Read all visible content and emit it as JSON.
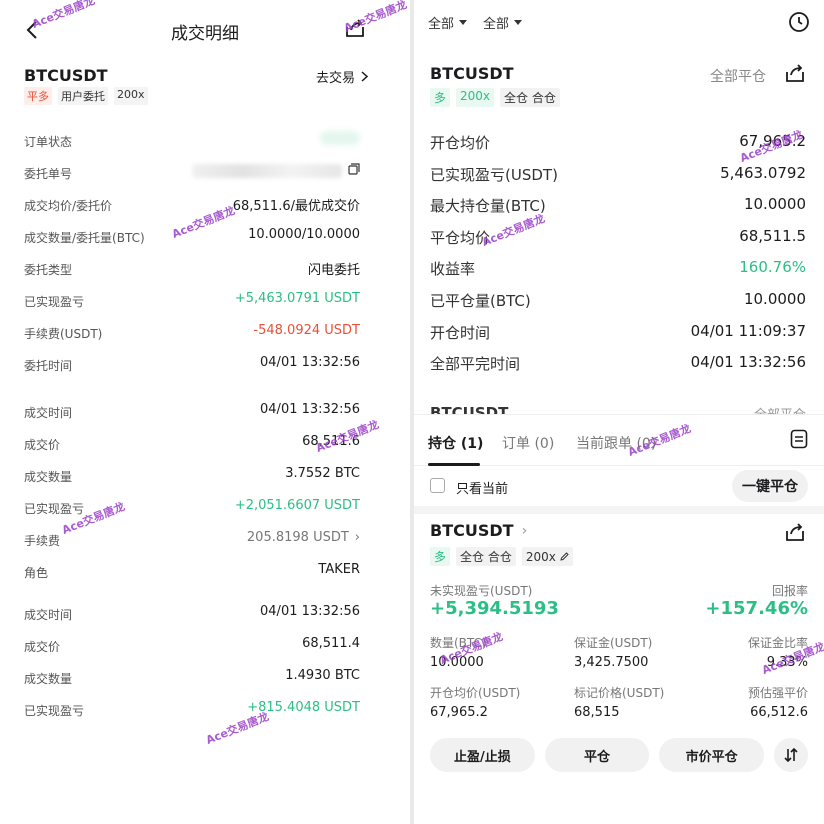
{
  "left": {
    "title": "成交明细",
    "symbol": "BTCUSDT",
    "goto_label": "去交易",
    "tags": [
      "平多",
      "用户委托",
      "200x"
    ],
    "order_rows": [
      {
        "label": "订单状态",
        "value": "",
        "style": "blur-short"
      },
      {
        "label": "委托单号",
        "value": "",
        "style": "blur"
      },
      {
        "label": "成交均价/委托价",
        "value": "68,511.6/最优成交价",
        "style": ""
      },
      {
        "label": "成交数量/委托量(BTC)",
        "value": "10.0000/10.0000",
        "style": ""
      },
      {
        "label": "委托类型",
        "value": "闪电委托",
        "style": ""
      },
      {
        "label": "已实现盈亏",
        "value": "+5,463.0791 USDT",
        "style": "green"
      },
      {
        "label": "手续费(USDT)",
        "value": "-548.0924 USDT",
        "style": "red"
      },
      {
        "label": "委托时间",
        "value": "04/01 13:32:56",
        "style": ""
      }
    ],
    "fill1_rows": [
      {
        "label": "成交时间",
        "value": "04/01 13:32:56",
        "style": ""
      },
      {
        "label": "成交价",
        "value": "68,511.6",
        "style": ""
      },
      {
        "label": "成交数量",
        "value": "3.7552 BTC",
        "style": ""
      },
      {
        "label": "已实现盈亏",
        "value": "+2,051.6607 USDT",
        "style": "green"
      },
      {
        "label": "手续费",
        "value": "205.8198 USDT",
        "style": "grey"
      },
      {
        "label": "角色",
        "value": "TAKER",
        "style": ""
      }
    ],
    "fill2_rows": [
      {
        "label": "成交时间",
        "value": "04/01 13:32:56",
        "style": ""
      },
      {
        "label": "成交价",
        "value": "68,511.4",
        "style": ""
      },
      {
        "label": "成交数量",
        "value": "1.4930 BTC",
        "style": ""
      },
      {
        "label": "已实现盈亏",
        "value": "+815.4048 USDT",
        "style": "green"
      }
    ]
  },
  "right": {
    "filters": [
      "全部",
      "全部"
    ],
    "symbol": "BTCUSDT",
    "close_all": "全部平仓",
    "tags": [
      "多",
      "200x",
      "全仓 合仓"
    ],
    "rows": [
      {
        "label": "开仓均价",
        "value": "67,965.2",
        "style": ""
      },
      {
        "label": "已实现盈亏(USDT)",
        "value": "5,463.0792",
        "style": ""
      },
      {
        "label": "最大持仓量(BTC)",
        "value": "10.0000",
        "style": ""
      },
      {
        "label": "平仓均价",
        "value": "68,511.5",
        "style": ""
      },
      {
        "label": "收益率",
        "value": "160.76%",
        "style": "green"
      },
      {
        "label": "已平仓量(BTC)",
        "value": "10.0000",
        "style": ""
      },
      {
        "label": "开仓时间",
        "value": "04/01 11:09:37",
        "style": ""
      },
      {
        "label": "全部平完时间",
        "value": "04/01 13:32:56",
        "style": ""
      }
    ],
    "peek_symbol": "BTCUSDT",
    "peek_right": "全部平仓",
    "tabs": [
      "持仓 (1)",
      "订单 (0)",
      "当前跟单 (0)"
    ],
    "only_current": "只看当前",
    "one_key_close": "一键平仓",
    "position": {
      "symbol": "BTCUSDT",
      "tags": [
        "多",
        "全仓 合仓",
        "200x"
      ],
      "pnl_label": "未实现盈亏(USDT)",
      "pnl_value": "+5,394.5193",
      "roe_label": "回报率",
      "roe_value": "+157.46%",
      "cells": [
        {
          "label": "数量(BTC)",
          "value": "10.0000"
        },
        {
          "label": "保证金(USDT)",
          "value": "3,425.7500"
        },
        {
          "label": "保证金比率",
          "value": "9.33%"
        },
        {
          "label": "开仓均价(USDT)",
          "value": "67,965.2"
        },
        {
          "label": "标记价格(USDT)",
          "value": "68,515"
        },
        {
          "label": "预估强平价",
          "value": "66,512.6"
        }
      ],
      "buttons": [
        "止盈/止损",
        "平仓",
        "市价平仓"
      ]
    }
  },
  "watermark": "Ace交易唐龙"
}
